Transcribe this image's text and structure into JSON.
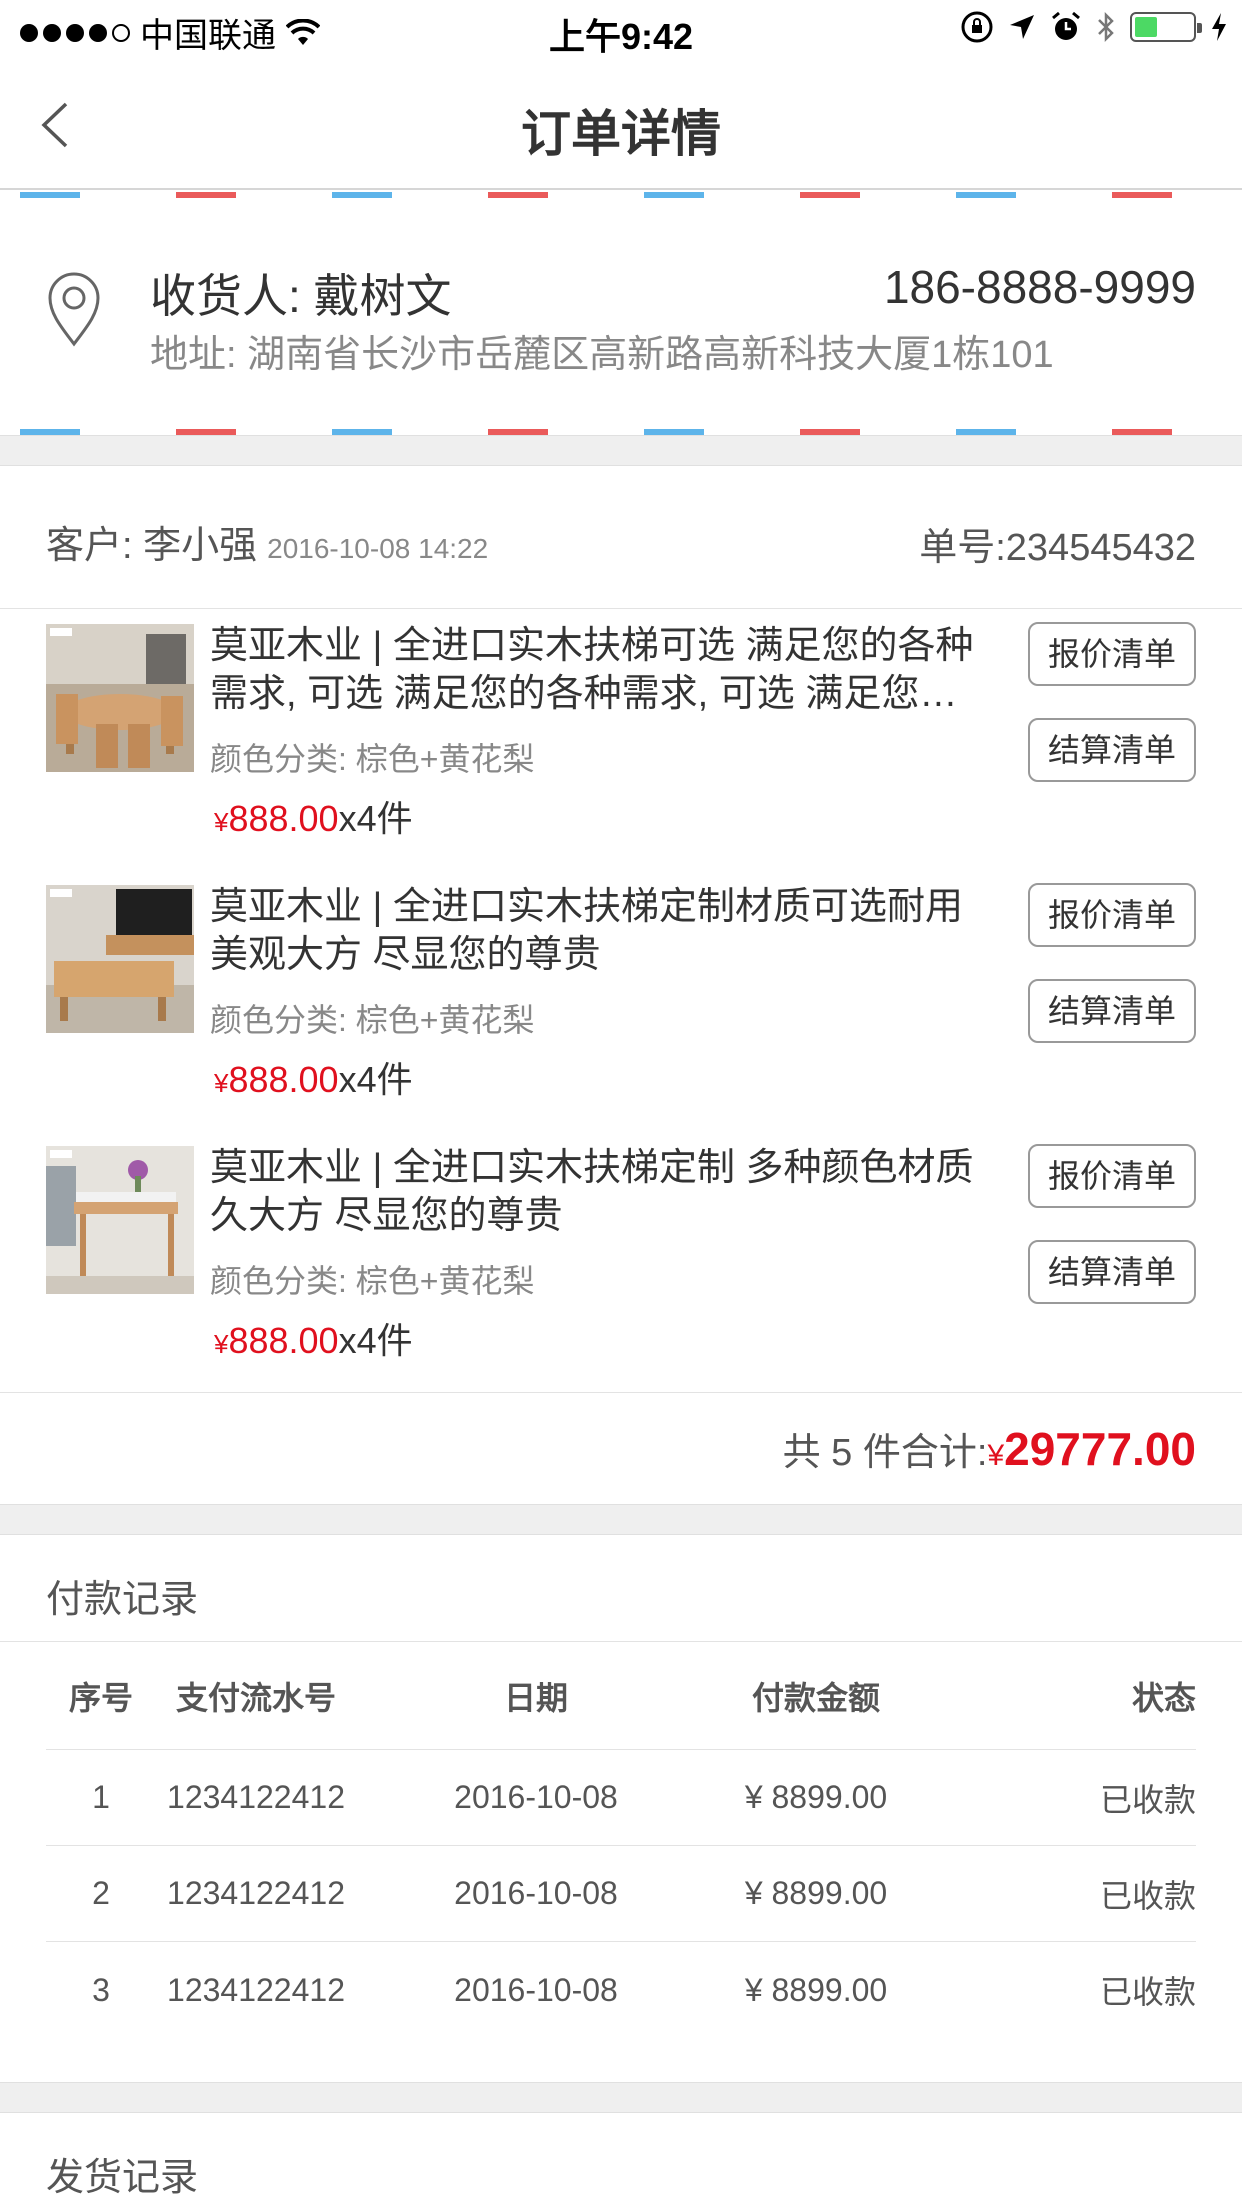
{
  "status_bar": {
    "carrier": "中国联通",
    "time": "上午9:42",
    "battery_level": 0.4
  },
  "nav": {
    "title": "订单详情"
  },
  "address": {
    "receiver": "收货人: 戴树文",
    "phone": "186-8888-9999",
    "address_line": "地址: 湖南省长沙市岳麓区高新路高新科技大厦1栋101"
  },
  "order": {
    "customer": "客户: 李小强",
    "date": "2016-10-08 14:22",
    "order_no": "单号:234545432"
  },
  "products": [
    {
      "name": "莫亚木业 | 全进口实木扶梯可选 满足您的各种需求, 可选 满足您的各种需求, 可选 满足您的各种需求",
      "spec": "颜色分类: 棕色+黄花梨",
      "currency": "¥",
      "price": "888.00",
      "qty": "x4件",
      "btn_quote": "报价清单",
      "btn_settle": "结算清单"
    },
    {
      "name": "莫亚木业 | 全进口实木扶梯定制材质可选耐用美观大方 尽显您的尊贵",
      "spec": "颜色分类: 棕色+黄花梨",
      "currency": "¥",
      "price": "888.00",
      "qty": "x4件",
      "btn_quote": "报价清单",
      "btn_settle": "结算清单"
    },
    {
      "name": "莫亚木业 | 全进口实木扶梯定制 多种颜色材质久大方 尽显您的尊贵",
      "spec": "颜色分类: 棕色+黄花梨",
      "currency": "¥",
      "price": "888.00",
      "qty": "x4件",
      "btn_quote": "报价清单",
      "btn_settle": "结算清单"
    }
  ],
  "total": {
    "label": "共 5 件合计:",
    "currency": "¥",
    "amount": "29777.00"
  },
  "payment": {
    "title": "付款记录",
    "headers": [
      "序号",
      "支付流水号",
      "日期",
      "付款金额",
      "状态"
    ],
    "rows": [
      [
        "1",
        "1234122412",
        "2016-10-08",
        "¥ 8899.00",
        "已收款"
      ],
      [
        "2",
        "1234122412",
        "2016-10-08",
        "¥ 8899.00",
        "已收款"
      ],
      [
        "3",
        "1234122412",
        "2016-10-08",
        "¥ 8899.00",
        "已收款"
      ]
    ]
  },
  "shipping": {
    "title": "发货记录"
  },
  "colors": {
    "price_red": "#e0101e",
    "stripe_blue": "#5db4ea",
    "stripe_red": "#ea5a5a",
    "battery_green": "#4cd964"
  }
}
